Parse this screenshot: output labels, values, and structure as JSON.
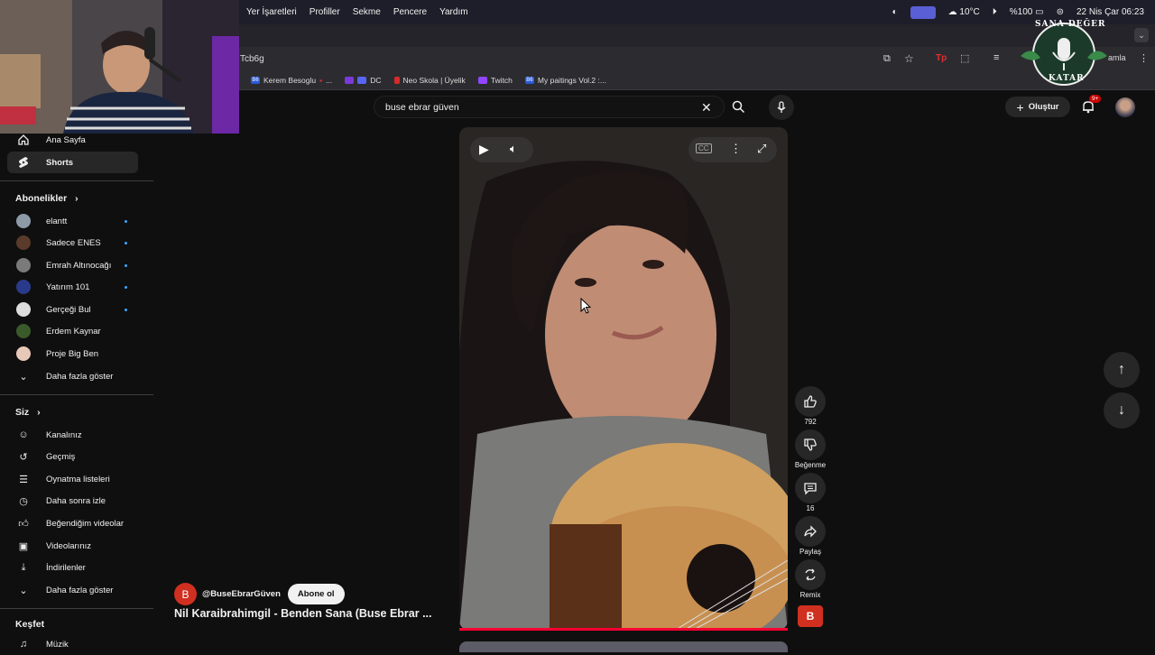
{
  "menubar": {
    "menus": [
      "Yer İşaretleri",
      "Profiller",
      "Sekme",
      "Pencere",
      "Yardım"
    ],
    "weather": "10°C",
    "battery": "%100",
    "datetime": "22 Nis Çar  06:23"
  },
  "browser": {
    "url_fragment": "Tcb6g",
    "bookmarks": [
      "Kerem Besoglu",
      "DC",
      "Neo Skola | Üyelik",
      "Twitch",
      "My paitings Vol.2 :..."
    ],
    "bookmark_badge": "B6",
    "profile_btn": "amla"
  },
  "overlay_logo": "SANA DEĞER KATAR",
  "search": {
    "query": "buse ebrar güven"
  },
  "header": {
    "create_label": "Oluştur",
    "notif_count": "9+"
  },
  "sidebar": {
    "main": [
      {
        "label": "Ana Sayfa",
        "icon": "home-icon"
      },
      {
        "label": "Shorts",
        "icon": "shorts-icon"
      }
    ],
    "subs_title": "Abonelikler",
    "subs": [
      {
        "label": "elantt",
        "color": "#8c9aa8"
      },
      {
        "label": "Sadece ENES",
        "color": "#5a3a2a"
      },
      {
        "label": "Emrah Altınocağı",
        "color": "#7a7a7a"
      },
      {
        "label": "Yatırım 101",
        "color": "#2a3a8a"
      },
      {
        "label": "Gerçeği Bul",
        "color": "#dddddd"
      },
      {
        "label": "Erdem Kaynar",
        "color": "#3a5a2a"
      },
      {
        "label": "Proje Big Ben",
        "color": "#e8c8b8"
      }
    ],
    "subs_more": "Daha fazla göster",
    "you_title": "Siz",
    "you": [
      {
        "label": "Kanalınız",
        "icon": "channel-icon"
      },
      {
        "label": "Geçmiş",
        "icon": "history-icon"
      },
      {
        "label": "Oynatma listeleri",
        "icon": "playlist-icon"
      },
      {
        "label": "Daha sonra izle",
        "icon": "clock-icon"
      },
      {
        "label": "Beğendiğim videolar",
        "icon": "thumbs-up-icon"
      },
      {
        "label": "Videolarınız",
        "icon": "video-icon"
      },
      {
        "label": "İndirilenler",
        "icon": "download-icon"
      },
      {
        "label": "Daha fazla göster",
        "icon": "chevron-down-icon"
      }
    ],
    "explore_title": "Keşfet",
    "explore": [
      {
        "label": "Müzik",
        "icon": "music-icon"
      }
    ]
  },
  "short": {
    "channel_initial": "B",
    "channel": "@BuseEbrarGüven",
    "subscribe": "Abone ol",
    "title": "Nil Karaibrahimgil - Benden Sana (Buse Ebrar ...",
    "actions": {
      "likes": "792",
      "dislike": "Beğenme",
      "comments": "16",
      "share": "Paylaş",
      "remix": "Remix"
    }
  }
}
